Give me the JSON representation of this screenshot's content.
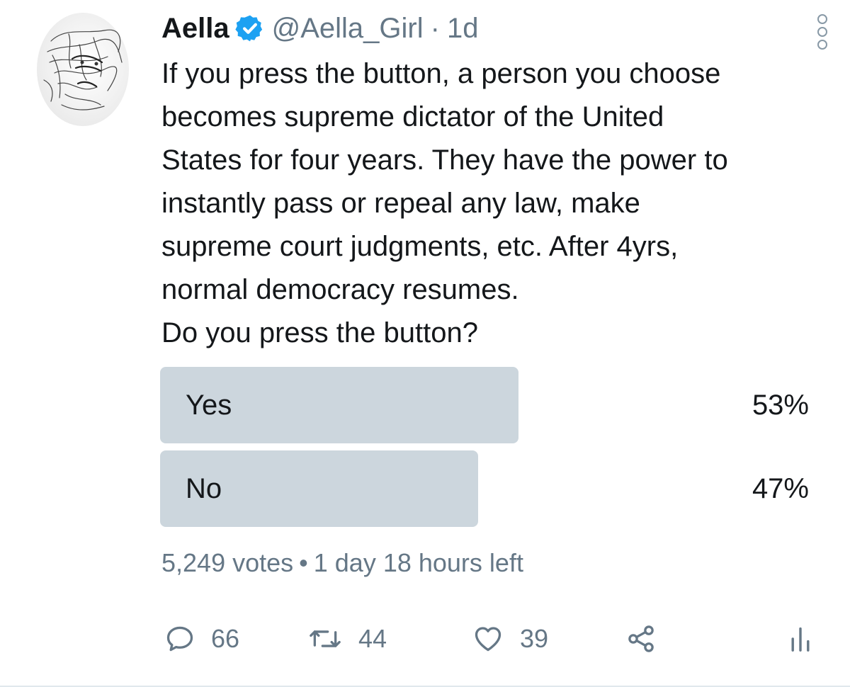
{
  "author": {
    "display_name": "Aella",
    "handle": "@Aella_Girl",
    "separator": "·",
    "time": "1d",
    "verified": true,
    "avatar_icon": "sketch-portrait-avatar"
  },
  "tweet": {
    "lines": [
      "If you press the button, a person you choose",
      "becomes supreme dictator of the United",
      "States for four years. They have the power to",
      "instantly pass or repeal any law, make",
      "supreme court judgments, etc. After 4yrs,",
      "normal democracy resumes.",
      "Do you press the button?"
    ]
  },
  "poll": {
    "options": [
      {
        "label": "Yes",
        "percent_text": "53%",
        "fraction": 0.53
      },
      {
        "label": "No",
        "percent_text": "47%",
        "fraction": 0.47
      }
    ],
    "votes": "5,249 votes",
    "bullet": "•",
    "time_left": "1 day 18 hours left"
  },
  "actions": {
    "reply_count": "66",
    "retweet_count": "44",
    "like_count": "39",
    "icons": [
      "reply-icon",
      "retweet-icon",
      "like-icon",
      "share-icon",
      "analytics-icon"
    ]
  },
  "colors": {
    "text": "#14171a",
    "secondary": "#657786",
    "poll_bar": "#ccd6dd",
    "verified_blue": "#1da1f2"
  }
}
